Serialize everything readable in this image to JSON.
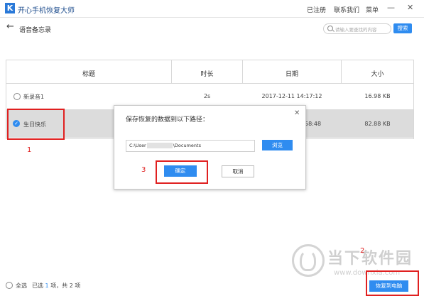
{
  "app": {
    "logo": "K",
    "title": "开心手机恢复大师"
  },
  "titlebar": {
    "registered": "已注册",
    "contact": "联系我们",
    "menu": "菜单",
    "minimize": "—",
    "close": "✕"
  },
  "nav": {
    "back": "←",
    "page_title": "语音备忘录"
  },
  "search": {
    "placeholder": "请输入要查找的内容",
    "button": "搜索"
  },
  "table": {
    "headers": [
      "标题",
      "时长",
      "日期",
      "大小"
    ],
    "rows": [
      {
        "title": "新录音1",
        "duration": "2s",
        "date": "2017-12-11 14:17:12",
        "size": "16.98 KB",
        "checked": false
      },
      {
        "title": "生日快乐",
        "duration": "",
        "date": "58:48",
        "size": "82.88 KB",
        "checked": true
      }
    ]
  },
  "dialog": {
    "title": "保存恢复的数据到以下路径：",
    "path_prefix": "C:\\User",
    "path_suffix": "\\Documents",
    "browse": "浏览",
    "ok": "确定",
    "cancel": "取消",
    "close": "✕"
  },
  "annotations": {
    "one": "1",
    "two": "2",
    "three": "3"
  },
  "footer": {
    "select_all": "全选",
    "selected_prefix": "已选",
    "selected_count": "1",
    "selected_suffix": "项，共 2 项",
    "restore": "恢复到电脑"
  },
  "watermark": {
    "text": "当下软件园",
    "url": "www.downxia.com"
  },
  "colors": {
    "accent": "#2f8cf0",
    "annotation": "#e02020"
  }
}
